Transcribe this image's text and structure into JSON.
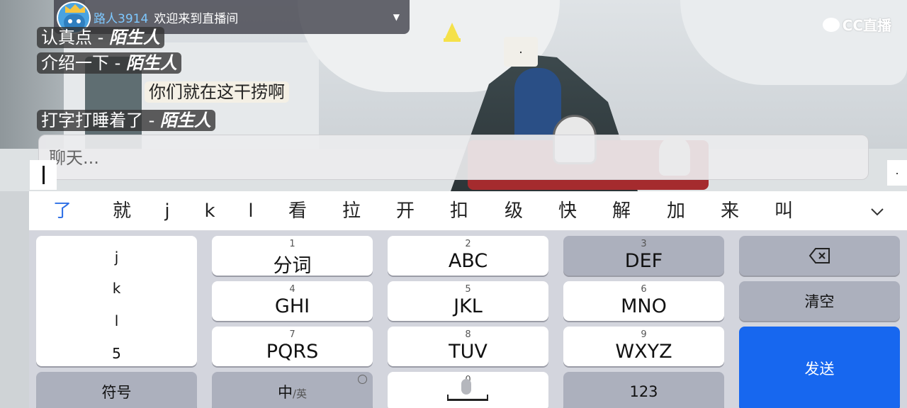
{
  "banner": {
    "user": "路人3914",
    "message": "欢迎来到直播间"
  },
  "brand": {
    "name": "CC直播"
  },
  "badge": {
    "text": "."
  },
  "chat": {
    "lines": [
      {
        "text": "认真点 - ",
        "sender": "陌生人"
      },
      {
        "text": "介绍一下 - ",
        "sender": "陌生人"
      },
      {
        "text": "打字打睡着了 - ",
        "sender": "陌生人"
      }
    ],
    "highlight": "你们就在这干捞啊"
  },
  "chat_input": {
    "placeholder": "聊天..."
  },
  "right_marker": ".",
  "ime": {
    "candidates": [
      "了",
      "就",
      "j",
      "k",
      "l",
      "看",
      "拉",
      "开",
      "扣",
      "级",
      "快",
      "解",
      "加",
      "来",
      "叫"
    ]
  },
  "keyboard": {
    "letters": [
      "j",
      "k",
      "l",
      "5"
    ],
    "keys": [
      {
        "num": "1",
        "main": "分词"
      },
      {
        "num": "2",
        "main": "ABC"
      },
      {
        "num": "3",
        "main": "DEF"
      },
      {
        "num": "4",
        "main": "GHI"
      },
      {
        "num": "5",
        "main": "JKL"
      },
      {
        "num": "6",
        "main": "MNO"
      },
      {
        "num": "7",
        "main": "PQRS"
      },
      {
        "num": "8",
        "main": "TUV"
      },
      {
        "num": "9",
        "main": "WXYZ"
      }
    ],
    "clear": "清空",
    "send": "发送",
    "symbols": "符号",
    "lang_main": "中",
    "lang_sub": "/英",
    "zero": "0",
    "numbers": "123"
  },
  "colors": {
    "send": "#1767ef",
    "candidate_active": "#2d6fe6",
    "username": "#7ec8ff"
  }
}
